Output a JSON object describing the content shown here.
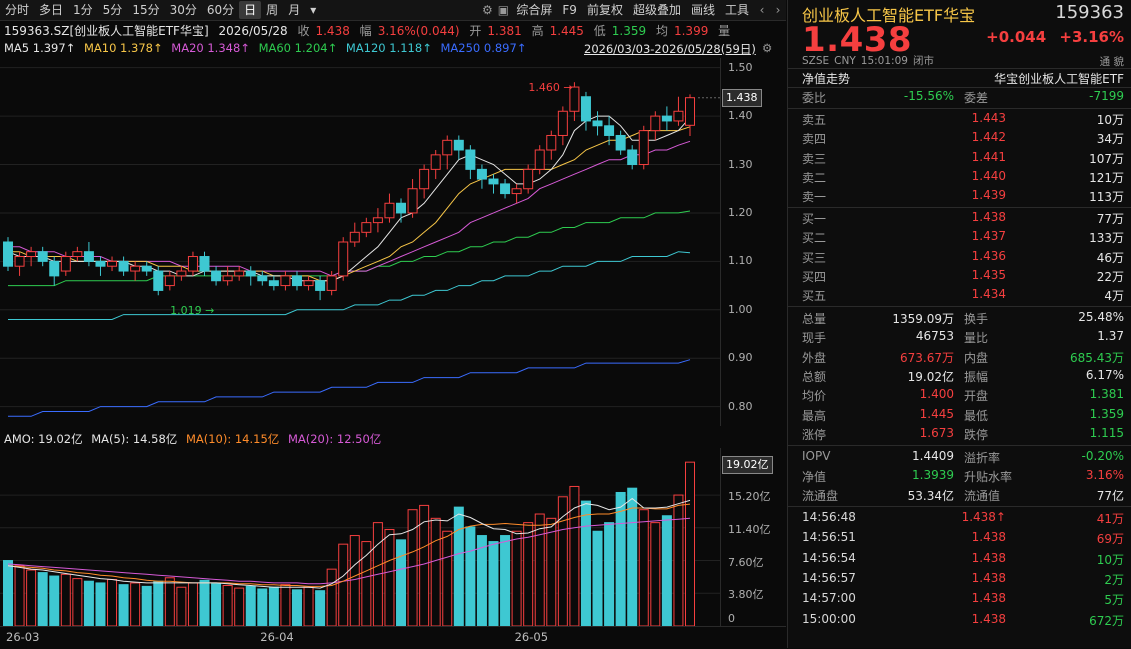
{
  "toolbar": {
    "periods": [
      "分时",
      "多日",
      "1分",
      "5分",
      "15分",
      "30分",
      "60分",
      "日",
      "周",
      "月"
    ],
    "active_period": "日",
    "more_label": "▾",
    "right_items": [
      "综合屏",
      "F9",
      "前复权",
      "超级叠加",
      "画线",
      "工具"
    ]
  },
  "info": {
    "code_name": "159363.SZ[创业板人工智能ETF华宝]",
    "date": "2026/05/28",
    "close_label": "收",
    "close_value": "1.438",
    "pct_label": "幅",
    "pct_value": "3.16%(0.044)",
    "open_label": "开",
    "open_value": "1.381",
    "high_label": "高",
    "high_value": "1.445",
    "low_label": "低",
    "low_value": "1.359",
    "avg_label": "均",
    "avg_value": "1.399",
    "vol_label": "量"
  },
  "ma": {
    "ma5": "MA5 1.397↑",
    "ma10": "MA10 1.378↑",
    "ma20": "MA20 1.348↑",
    "ma60": "MA60 1.204↑",
    "ma120": "MA120 1.118↑",
    "ma250": "MA250 0.897↑",
    "range": "2026/03/03-2026/05/28(59日)"
  },
  "annotations": {
    "high_mark": "1.460",
    "low_mark": "1.019"
  },
  "price_axis": {
    "ticks": [
      "1.50",
      "1.40",
      "1.30",
      "1.20",
      "1.10",
      "1.00",
      "0.90",
      "0.80"
    ],
    "current": "1.438"
  },
  "vol": {
    "amo": "AMO: 19.02亿",
    "ma5": "MA(5): 14.58亿",
    "ma10": "MA(10): 14.15亿",
    "ma20": "MA(20): 12.50亿",
    "ticks": [
      "15.20亿",
      "11.40亿",
      "7.60亿",
      "3.80亿",
      "0"
    ],
    "current": "19.02亿"
  },
  "dates": [
    "26-03",
    "26-04",
    "26-05"
  ],
  "colors": {
    "up": "#f53f3f",
    "down": "#3ec8d2",
    "ma5": "#e6e6e6",
    "ma10": "#f7c648",
    "ma20": "#d65ad6",
    "ma60": "#2ecc50",
    "ma120": "#3ec8d2",
    "ma250": "#3a6cff"
  },
  "chart_data": {
    "type": "candlestick",
    "price_range": [
      0.76,
      1.52
    ],
    "volume_unit": "亿",
    "volume_range": [
      0,
      19.02
    ],
    "candles": [
      [
        1.14,
        1.09,
        1.15,
        1.08
      ],
      [
        1.09,
        1.11,
        1.12,
        1.07
      ],
      [
        1.11,
        1.12,
        1.13,
        1.09
      ],
      [
        1.12,
        1.1,
        1.13,
        1.09
      ],
      [
        1.1,
        1.07,
        1.11,
        1.05
      ],
      [
        1.08,
        1.11,
        1.12,
        1.07
      ],
      [
        1.11,
        1.12,
        1.13,
        1.1
      ],
      [
        1.12,
        1.1,
        1.14,
        1.09
      ],
      [
        1.1,
        1.09,
        1.11,
        1.07
      ],
      [
        1.09,
        1.1,
        1.11,
        1.08
      ],
      [
        1.1,
        1.08,
        1.11,
        1.07
      ],
      [
        1.08,
        1.09,
        1.1,
        1.06
      ],
      [
        1.09,
        1.08,
        1.1,
        1.07
      ],
      [
        1.08,
        1.04,
        1.09,
        1.03
      ],
      [
        1.05,
        1.07,
        1.08,
        1.04
      ],
      [
        1.07,
        1.08,
        1.09,
        1.06
      ],
      [
        1.08,
        1.11,
        1.12,
        1.07
      ],
      [
        1.11,
        1.08,
        1.12,
        1.07
      ],
      [
        1.08,
        1.06,
        1.09,
        1.05
      ],
      [
        1.06,
        1.07,
        1.09,
        1.05
      ],
      [
        1.07,
        1.08,
        1.09,
        1.06
      ],
      [
        1.08,
        1.07,
        1.09,
        1.05
      ],
      [
        1.07,
        1.06,
        1.08,
        1.05
      ],
      [
        1.06,
        1.05,
        1.07,
        1.04
      ],
      [
        1.05,
        1.07,
        1.08,
        1.04
      ],
      [
        1.07,
        1.05,
        1.08,
        1.04
      ],
      [
        1.05,
        1.06,
        1.07,
        1.04
      ],
      [
        1.06,
        1.04,
        1.07,
        1.02
      ],
      [
        1.04,
        1.07,
        1.08,
        1.03
      ],
      [
        1.07,
        1.14,
        1.15,
        1.06
      ],
      [
        1.14,
        1.16,
        1.18,
        1.13
      ],
      [
        1.16,
        1.18,
        1.19,
        1.15
      ],
      [
        1.18,
        1.19,
        1.21,
        1.16
      ],
      [
        1.19,
        1.22,
        1.24,
        1.18
      ],
      [
        1.22,
        1.2,
        1.23,
        1.18
      ],
      [
        1.2,
        1.25,
        1.27,
        1.19
      ],
      [
        1.25,
        1.29,
        1.3,
        1.23
      ],
      [
        1.29,
        1.32,
        1.33,
        1.27
      ],
      [
        1.32,
        1.35,
        1.36,
        1.29
      ],
      [
        1.35,
        1.33,
        1.36,
        1.31
      ],
      [
        1.33,
        1.29,
        1.34,
        1.27
      ],
      [
        1.29,
        1.27,
        1.3,
        1.25
      ],
      [
        1.27,
        1.26,
        1.28,
        1.24
      ],
      [
        1.26,
        1.24,
        1.27,
        1.23
      ],
      [
        1.24,
        1.25,
        1.26,
        1.22
      ],
      [
        1.25,
        1.29,
        1.3,
        1.24
      ],
      [
        1.29,
        1.33,
        1.34,
        1.28
      ],
      [
        1.33,
        1.36,
        1.37,
        1.31
      ],
      [
        1.36,
        1.41,
        1.42,
        1.34
      ],
      [
        1.41,
        1.46,
        1.47,
        1.39
      ],
      [
        1.44,
        1.39,
        1.45,
        1.37
      ],
      [
        1.39,
        1.38,
        1.41,
        1.36
      ],
      [
        1.38,
        1.36,
        1.4,
        1.34
      ],
      [
        1.36,
        1.33,
        1.37,
        1.32
      ],
      [
        1.33,
        1.3,
        1.34,
        1.29
      ],
      [
        1.3,
        1.37,
        1.38,
        1.29
      ],
      [
        1.37,
        1.4,
        1.41,
        1.35
      ],
      [
        1.4,
        1.39,
        1.42,
        1.37
      ],
      [
        1.39,
        1.41,
        1.44,
        1.38
      ],
      [
        1.381,
        1.438,
        1.445,
        1.359
      ]
    ],
    "volumes": [
      7.6,
      7.0,
      6.5,
      6.2,
      5.8,
      6.0,
      5.5,
      5.2,
      5.0,
      5.4,
      4.8,
      5.0,
      4.6,
      5.2,
      5.6,
      4.5,
      5.0,
      5.3,
      4.9,
      4.7,
      4.4,
      4.6,
      4.3,
      4.5,
      4.8,
      4.2,
      4.5,
      4.1,
      6.6,
      9.5,
      10.5,
      9.8,
      12.0,
      11.2,
      10.0,
      13.5,
      14.0,
      12.5,
      11.0,
      13.8,
      11.5,
      10.5,
      9.8,
      10.5,
      11.0,
      12.0,
      13.0,
      12.5,
      15.0,
      16.2,
      14.5,
      11.0,
      12.0,
      15.5,
      16.0,
      13.5,
      12.0,
      12.8,
      15.2,
      19.02
    ],
    "ma5": [
      1.12,
      1.11,
      1.11,
      1.11,
      1.1,
      1.1,
      1.1,
      1.1,
      1.1,
      1.1,
      1.1,
      1.09,
      1.09,
      1.08,
      1.08,
      1.07,
      1.07,
      1.08,
      1.08,
      1.08,
      1.08,
      1.08,
      1.07,
      1.07,
      1.07,
      1.06,
      1.06,
      1.06,
      1.06,
      1.07,
      1.09,
      1.11,
      1.13,
      1.16,
      1.19,
      1.2,
      1.22,
      1.25,
      1.28,
      1.31,
      1.32,
      1.31,
      1.3,
      1.28,
      1.26,
      1.26,
      1.27,
      1.29,
      1.32,
      1.37,
      1.39,
      1.4,
      1.4,
      1.38,
      1.35,
      1.35,
      1.35,
      1.36,
      1.37,
      1.397
    ],
    "ma10": [
      1.12,
      1.12,
      1.11,
      1.11,
      1.11,
      1.11,
      1.1,
      1.1,
      1.1,
      1.1,
      1.1,
      1.1,
      1.1,
      1.09,
      1.09,
      1.09,
      1.08,
      1.08,
      1.08,
      1.08,
      1.08,
      1.08,
      1.08,
      1.07,
      1.07,
      1.07,
      1.07,
      1.06,
      1.06,
      1.07,
      1.08,
      1.09,
      1.1,
      1.11,
      1.13,
      1.14,
      1.16,
      1.18,
      1.21,
      1.24,
      1.26,
      1.27,
      1.28,
      1.29,
      1.29,
      1.29,
      1.29,
      1.29,
      1.3,
      1.31,
      1.33,
      1.34,
      1.35,
      1.35,
      1.36,
      1.37,
      1.37,
      1.37,
      1.37,
      1.378
    ],
    "ma20": [
      1.13,
      1.13,
      1.12,
      1.12,
      1.12,
      1.11,
      1.11,
      1.11,
      1.11,
      1.1,
      1.1,
      1.1,
      1.1,
      1.1,
      1.1,
      1.09,
      1.09,
      1.09,
      1.09,
      1.09,
      1.09,
      1.08,
      1.08,
      1.08,
      1.08,
      1.08,
      1.08,
      1.08,
      1.07,
      1.08,
      1.08,
      1.08,
      1.09,
      1.1,
      1.11,
      1.12,
      1.13,
      1.14,
      1.15,
      1.16,
      1.18,
      1.19,
      1.2,
      1.21,
      1.22,
      1.23,
      1.25,
      1.26,
      1.27,
      1.28,
      1.29,
      1.3,
      1.31,
      1.31,
      1.32,
      1.32,
      1.33,
      1.33,
      1.34,
      1.348
    ],
    "ma60": [
      1.05,
      1.05,
      1.05,
      1.05,
      1.05,
      1.06,
      1.06,
      1.06,
      1.06,
      1.06,
      1.06,
      1.06,
      1.06,
      1.07,
      1.07,
      1.07,
      1.07,
      1.07,
      1.07,
      1.07,
      1.07,
      1.07,
      1.07,
      1.07,
      1.07,
      1.07,
      1.07,
      1.07,
      1.07,
      1.08,
      1.08,
      1.08,
      1.09,
      1.09,
      1.1,
      1.1,
      1.11,
      1.11,
      1.12,
      1.12,
      1.13,
      1.13,
      1.14,
      1.14,
      1.15,
      1.15,
      1.16,
      1.16,
      1.17,
      1.17,
      1.18,
      1.18,
      1.18,
      1.19,
      1.19,
      1.19,
      1.2,
      1.2,
      1.2,
      1.204
    ],
    "ma120": [
      0.98,
      0.98,
      0.98,
      0.98,
      0.98,
      0.98,
      0.98,
      0.98,
      0.98,
      0.98,
      0.99,
      0.99,
      0.99,
      0.99,
      0.99,
      0.99,
      0.99,
      0.99,
      0.99,
      0.99,
      0.99,
      0.99,
      0.99,
      0.99,
      0.99,
      1.0,
      1.0,
      1.0,
      1.0,
      1.0,
      1.01,
      1.01,
      1.01,
      1.02,
      1.02,
      1.03,
      1.03,
      1.04,
      1.04,
      1.05,
      1.05,
      1.06,
      1.06,
      1.07,
      1.07,
      1.07,
      1.08,
      1.08,
      1.09,
      1.09,
      1.09,
      1.1,
      1.1,
      1.1,
      1.11,
      1.11,
      1.11,
      1.11,
      1.12,
      1.118
    ],
    "ma250": [
      0.78,
      0.78,
      0.78,
      0.79,
      0.79,
      0.79,
      0.79,
      0.79,
      0.8,
      0.8,
      0.8,
      0.8,
      0.8,
      0.81,
      0.81,
      0.81,
      0.81,
      0.81,
      0.82,
      0.82,
      0.82,
      0.82,
      0.82,
      0.83,
      0.83,
      0.83,
      0.83,
      0.83,
      0.84,
      0.84,
      0.84,
      0.84,
      0.85,
      0.85,
      0.85,
      0.85,
      0.86,
      0.86,
      0.86,
      0.86,
      0.87,
      0.87,
      0.87,
      0.87,
      0.87,
      0.88,
      0.88,
      0.88,
      0.88,
      0.88,
      0.89,
      0.89,
      0.89,
      0.89,
      0.89,
      0.89,
      0.89,
      0.89,
      0.89,
      0.897
    ],
    "vma5": [
      7.0,
      6.8,
      6.6,
      6.5,
      6.3,
      6.1,
      5.9,
      5.7,
      5.5,
      5.4,
      5.2,
      5.1,
      5.0,
      5.0,
      5.0,
      5.0,
      5.0,
      5.0,
      5.0,
      4.9,
      4.8,
      4.7,
      4.6,
      4.5,
      4.5,
      4.5,
      4.5,
      4.4,
      4.9,
      5.8,
      7.1,
      8.2,
      9.5,
      10.6,
      10.7,
      11.2,
      12.1,
      12.3,
      12.2,
      13.0,
      12.6,
      11.9,
      11.3,
      11.2,
      10.7,
      10.8,
      11.3,
      11.5,
      12.7,
      13.7,
      14.2,
      14.0,
      13.5,
      13.8,
      14.8,
      13.7,
      13.7,
      13.8,
      14.2,
      14.58
    ],
    "vma10": [
      7.0,
      6.9,
      6.8,
      6.7,
      6.5,
      6.4,
      6.2,
      6.1,
      5.9,
      5.8,
      5.6,
      5.5,
      5.3,
      5.2,
      5.2,
      5.1,
      5.0,
      5.0,
      5.0,
      5.0,
      4.9,
      4.9,
      4.8,
      4.8,
      4.7,
      4.7,
      4.6,
      4.6,
      4.7,
      5.2,
      5.8,
      6.4,
      7.0,
      7.6,
      8.1,
      8.6,
      9.2,
      9.9,
      10.4,
      11.2,
      11.6,
      11.8,
      11.8,
      11.9,
      11.8,
      11.7,
      11.7,
      11.8,
      12.2,
      12.6,
      12.9,
      13.0,
      13.0,
      13.3,
      13.7,
      13.7,
      13.6,
      13.6,
      14.0,
      14.15
    ],
    "vma20": [
      7.2,
      7.1,
      7.0,
      6.9,
      6.8,
      6.7,
      6.6,
      6.5,
      6.4,
      6.3,
      6.2,
      6.1,
      6.0,
      5.9,
      5.8,
      5.7,
      5.6,
      5.5,
      5.4,
      5.3,
      5.2,
      5.2,
      5.1,
      5.0,
      5.0,
      5.0,
      4.9,
      4.9,
      5.0,
      5.2,
      5.4,
      5.7,
      6.0,
      6.3,
      6.6,
      6.9,
      7.2,
      7.6,
      8.0,
      8.4,
      8.7,
      9.1,
      9.5,
      9.8,
      10.1,
      10.3,
      10.6,
      10.9,
      11.2,
      11.4,
      11.6,
      11.7,
      11.8,
      11.9,
      12.0,
      12.1,
      12.2,
      12.3,
      12.4,
      12.5
    ]
  },
  "panel": {
    "title": "创业板人工智能ETF华宝",
    "code": "159363",
    "price": "1.438",
    "change": "+0.044",
    "change_pct": "+3.16%",
    "meta": [
      "SZSE",
      "CNY",
      "15:01:09",
      "闭市"
    ],
    "nav_label": "净值走势",
    "nav_name": "华宝创业板人工智能ETF",
    "weibi_label": "委比",
    "weibi": "-15.56%",
    "weicha_label": "委差",
    "weicha": "-7199",
    "asks": [
      {
        "label": "卖五",
        "price": "1.443",
        "vol": "10万"
      },
      {
        "label": "卖四",
        "price": "1.442",
        "vol": "34万"
      },
      {
        "label": "卖三",
        "price": "1.441",
        "vol": "107万"
      },
      {
        "label": "卖二",
        "price": "1.440",
        "vol": "121万"
      },
      {
        "label": "卖一",
        "price": "1.439",
        "vol": "113万"
      }
    ],
    "bids": [
      {
        "label": "买一",
        "price": "1.438",
        "vol": "77万"
      },
      {
        "label": "买二",
        "price": "1.437",
        "vol": "133万"
      },
      {
        "label": "买三",
        "price": "1.436",
        "vol": "46万"
      },
      {
        "label": "买四",
        "price": "1.435",
        "vol": "22万"
      },
      {
        "label": "买五",
        "price": "1.434",
        "vol": "4万"
      }
    ],
    "stats": [
      {
        "l1": "总量",
        "v1": "1359.09万",
        "l2": "换手",
        "v2": "25.48%",
        "c1": "white",
        "c2": "white"
      },
      {
        "l1": "现手",
        "v1": "46753",
        "l2": "量比",
        "v2": "1.37",
        "c1": "white",
        "c2": "white"
      },
      {
        "l1": "外盘",
        "v1": "673.67万",
        "l2": "内盘",
        "v2": "685.43万",
        "c1": "red",
        "c2": "green"
      },
      {
        "l1": "总额",
        "v1": "19.02亿",
        "l2": "振幅",
        "v2": "6.17%",
        "c1": "white",
        "c2": "white"
      },
      {
        "l1": "均价",
        "v1": "1.400",
        "l2": "开盘",
        "v2": "1.381",
        "c1": "red",
        "c2": "green"
      },
      {
        "l1": "最高",
        "v1": "1.445",
        "l2": "最低",
        "v2": "1.359",
        "c1": "red",
        "c2": "green"
      },
      {
        "l1": "涨停",
        "v1": "1.673",
        "l2": "跌停",
        "v2": "1.115",
        "c1": "red",
        "c2": "green"
      }
    ],
    "etf": [
      {
        "l1": "IOPV",
        "v1": "1.4409",
        "l2": "溢折率",
        "v2": "-0.20%",
        "c1": "white",
        "c2": "green"
      },
      {
        "l1": "净值",
        "v1": "1.3939",
        "l2": "升贴水率",
        "v2": "3.16%",
        "c1": "green",
        "c2": "red"
      },
      {
        "l1": "流通盘",
        "v1": "53.34亿",
        "l2": "流通值",
        "v2": "77亿",
        "c1": "white",
        "c2": "white"
      }
    ],
    "ticks": [
      {
        "time": "14:56:48",
        "price": "1.438↑",
        "vol": "41万",
        "vc": "red"
      },
      {
        "time": "14:56:51",
        "price": "1.438",
        "vol": "69万",
        "vc": "red"
      },
      {
        "time": "14:56:54",
        "price": "1.438",
        "vol": "10万",
        "vc": "green"
      },
      {
        "time": "14:56:57",
        "price": "1.438",
        "vol": "2万",
        "vc": "green"
      },
      {
        "time": "14:57:00",
        "price": "1.438",
        "vol": "5万",
        "vc": "green"
      },
      {
        "time": "15:00:00",
        "price": "1.438",
        "vol": "672万",
        "vc": "green"
      }
    ]
  }
}
